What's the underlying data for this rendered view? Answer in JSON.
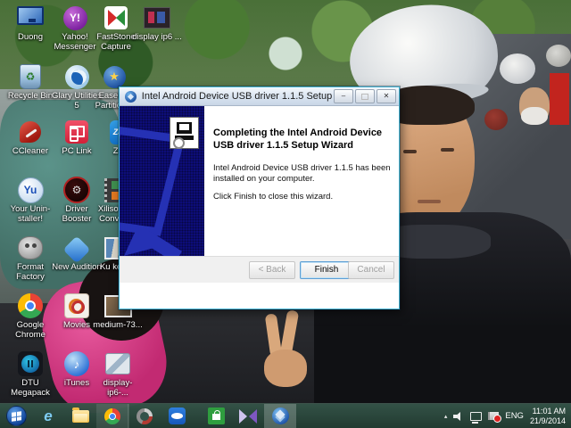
{
  "desktop": {
    "icons": [
      {
        "label": "Duong"
      },
      {
        "label": "Yahoo! Messenger"
      },
      {
        "label": "FastStone Capture"
      },
      {
        "label": "display ip6 ..."
      },
      {
        "label": "Recycle Bin"
      },
      {
        "label": "Glary Utilities 5"
      },
      {
        "label": "EaseUS Partition..."
      },
      {
        "label": "CCleaner"
      },
      {
        "label": "PC Link"
      },
      {
        "label": "Zalo"
      },
      {
        "label": "Your Unin-staller!"
      },
      {
        "label": "Driver Booster"
      },
      {
        "label": "Xilisoft Vid Converter"
      },
      {
        "label": "Format Factory"
      },
      {
        "label": "New Audition"
      },
      {
        "label": "Ku kem..."
      },
      {
        "label": "Google Chrome"
      },
      {
        "label": "Movies"
      },
      {
        "label": "medium-73..."
      },
      {
        "label": "DTU Megapack"
      },
      {
        "label": "iTunes"
      },
      {
        "label": "display-ip6-..."
      }
    ]
  },
  "dialog": {
    "title": "Intel Android Device USB driver 1.1.5 Setup",
    "heading": "Completing the Intel Android Device USB driver 1.1.5 Setup Wizard",
    "body_line1": "Intel Android Device USB driver 1.1.5 has been installed on your computer.",
    "body_line2": "Click Finish to close this wizard.",
    "buttons": {
      "back": "< Back",
      "finish": "Finish",
      "cancel": "Cancel"
    },
    "window_controls": {
      "minimize": "–",
      "close": "✕"
    }
  },
  "taskbar": {
    "items": [
      {
        "name": "start"
      },
      {
        "name": "internet-explorer"
      },
      {
        "name": "file-explorer"
      },
      {
        "name": "google-chrome",
        "state": "open"
      },
      {
        "name": "circular-app"
      },
      {
        "name": "teamviewer"
      },
      {
        "name": "windows-store"
      },
      {
        "name": "media-app"
      },
      {
        "name": "installer",
        "state": "active"
      }
    ],
    "tray": {
      "language": "ENG",
      "time": "11:01 AM",
      "date": "21/9/2014"
    }
  },
  "colors": {
    "dialog_border": "#45b6d6",
    "sidebar_navy": "#0d0d78",
    "sidebar_graphic": "#2531b4",
    "taskbar_teal": "#2e4e44",
    "wallpaper_pink": "#d6347f"
  }
}
